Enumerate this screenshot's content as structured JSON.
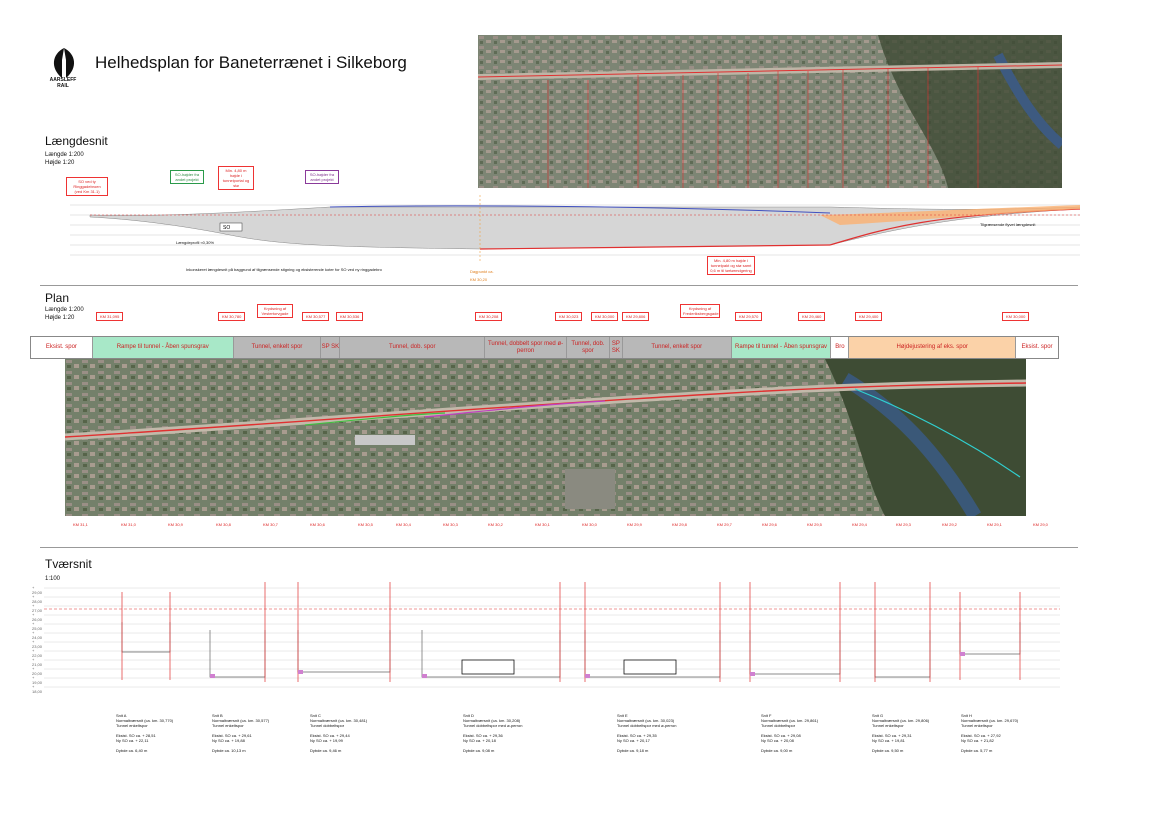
{
  "header": {
    "logo_lines": [
      "AARSLEFF",
      "RAIL"
    ],
    "title": "Helhedsplan for Baneterrænet i Silkeborg"
  },
  "colors": {
    "red": "#e03030",
    "green": "#a8e8c8",
    "gray": "#b8b8b8",
    "orange": "#fbd2a8",
    "blue": "#4050c0"
  },
  "longitudinal": {
    "heading": "Længdesnit",
    "scale": [
      "Længde 1:200",
      "Højde 1:20"
    ],
    "callouts": [
      {
        "text": "SO ved ty Ringgadebroen (ved Km 31.1)",
        "color": "red"
      },
      {
        "text": "SO-højder fra andet projekt",
        "color": "green"
      },
      {
        "text": "Min. 4,80 m højde i tunnelportal og stø",
        "color": "red"
      },
      {
        "text": "SO-højder fra andet projekt",
        "color": "purple"
      },
      {
        "text": "Min. 4,80 m højde i tunnelpakt og stø samt 0,6 m til tørtørmdgering",
        "color": "red"
      }
    ],
    "slope_note": "Længdeprofil ≈0,30%",
    "footnote": "Inkonskeret længdesnit på baggrund af tilgrænsende stigning og eksisterende koter for SO ved ny ringgadebro",
    "marker": "Dagpunkt ca. KM 30,20",
    "right_note": "Tilgrænsende flyvet længdesnit",
    "so_label": "SO"
  },
  "plan": {
    "heading": "Plan",
    "scale": [
      "Længde 1:200",
      "Højde 1:20"
    ],
    "km_tags": [
      "KM 31,095",
      "KM 30,780",
      "KM 30,577",
      "KM 30,536",
      "KM 30,208",
      "KM 30,023",
      "KM 30,000",
      "KM 29,806",
      "KM 29,570",
      "KM 29,460",
      "KM 29,400",
      "KM 30,000"
    ],
    "crossing_tags": [
      "Krydsning af Vestertorvgade",
      "Krydsning af Frederiksbergsgade"
    ],
    "segments": [
      {
        "label": "Eksist. spor",
        "kind": "white"
      },
      {
        "label": "Rampe til tunnel - Åben spunsgrav",
        "kind": "green"
      },
      {
        "label": "Tunnel, enkelt spor",
        "kind": "gray"
      },
      {
        "label": "SP SK",
        "kind": "gray"
      },
      {
        "label": "Tunnel, dob. spor",
        "kind": "gray"
      },
      {
        "label": "Tunnel, dobbelt spor med ø-perron",
        "kind": "gray"
      },
      {
        "label": "Tunnel, dob. spor",
        "kind": "gray"
      },
      {
        "label": "SP SK",
        "kind": "gray"
      },
      {
        "label": "Tunnel, enkelt spor",
        "kind": "gray"
      },
      {
        "label": "Rampe til tunnel - Åben spunsgrav",
        "kind": "green"
      },
      {
        "label": "Bro",
        "kind": "white"
      },
      {
        "label": "Højdejustering af eks. spor",
        "kind": "orange"
      },
      {
        "label": "Eksist. spor",
        "kind": "white"
      }
    ],
    "km_row": [
      "KM 31,1",
      "KM 31,0",
      "KM 30,9",
      "KM 30,8",
      "KM 30,7",
      "KM 30,6",
      "KM 30,5",
      "KM 30,4",
      "KM 30,3",
      "KM 30,2",
      "KM 30,1",
      "KM 30,0",
      "KM 29,9",
      "KM 29,8",
      "KM 29,7",
      "KM 29,6",
      "KM 29,5",
      "KM 29,4",
      "KM 29,3",
      "KM 29,2",
      "KM 29,1",
      "KM 29,0"
    ]
  },
  "cross": {
    "heading": "Tværsnit",
    "scale": "1:100",
    "levels": [
      "+ 29,00",
      "+ 28,00",
      "+ 27,00",
      "+ 26,00",
      "+ 25,00",
      "+ 24,00",
      "+ 23,00",
      "+ 22,00",
      "+ 21,00",
      "+ 20,00",
      "+ 19,00",
      "+ 18,00"
    ],
    "sections": [
      {
        "name": "Snit A",
        "desc": "Normaltværsnit (ca. km. 30,770) Tunnel enkeltspor",
        "l1": "Eksist. SO ca. + 28,51",
        "l2": "Ny SO ca. + 22,11",
        "l3": "Dybde ca. 6,40 m"
      },
      {
        "name": "Snit B",
        "desc": "Normaltværsnit (ca. km. 30,577) Tunnel enkeltspor",
        "l1": "Eksist. SO ca. + 29,61",
        "l2": "Ny SO ca. + 19,88",
        "l3": "Dybde ca. 10,13 m"
      },
      {
        "name": "Snit C",
        "desc": "Normaltværsnit (ca. km. 30,481) Tunnel dobbeltspor",
        "l1": "Eksist. SO ca. + 29,44",
        "l2": "Ny SO ca. + 19,99",
        "l3": "Dybde ca. 9,46 m"
      },
      {
        "name": "Snit D",
        "desc": "Normaltværsnit (ca. km. 30,208) Tunnel dobbeltspor med ø-perron",
        "l1": "Eksist. SO ca. + 29,36",
        "l2": "Ny SO ca. + 20,18",
        "l3": "Dybde ca. 9,08 m"
      },
      {
        "name": "Snit E",
        "desc": "Normaltværsnit (ca. km. 30,023) Tunnel dobbeltspor med ø-perron",
        "l1": "Eksist. SO ca. + 29,35",
        "l2": "Ny SO ca. + 20,17",
        "l3": "Dybde ca. 9,18 m"
      },
      {
        "name": "Snit F",
        "desc": "Normaltværsnit (ca. km. 29,861) Tunnel dobbeltspor",
        "l1": "Eksist. SO ca. + 29,08",
        "l2": "Ny SO ca. + 20,08",
        "l3": "Dybde ca. 9,00 m"
      },
      {
        "name": "Snit G",
        "desc": "Normaltværsnit (ca. km. 29,806) Tunnel enkeltspor",
        "l1": "Eksist. SO ca. + 29,31",
        "l2": "Ny SO ca. + 19,81",
        "l3": "Dybde ca. 9,50 m"
      },
      {
        "name": "Snit H",
        "desc": "Normaltværsnit (ca. km. 29,670) Tunnel enkeltspor",
        "l1": "Eksist. SO ca. + 27,92",
        "l2": "Ny SO ca. + 21,82",
        "l3": "Dybde ca. 5,77 m"
      }
    ]
  }
}
